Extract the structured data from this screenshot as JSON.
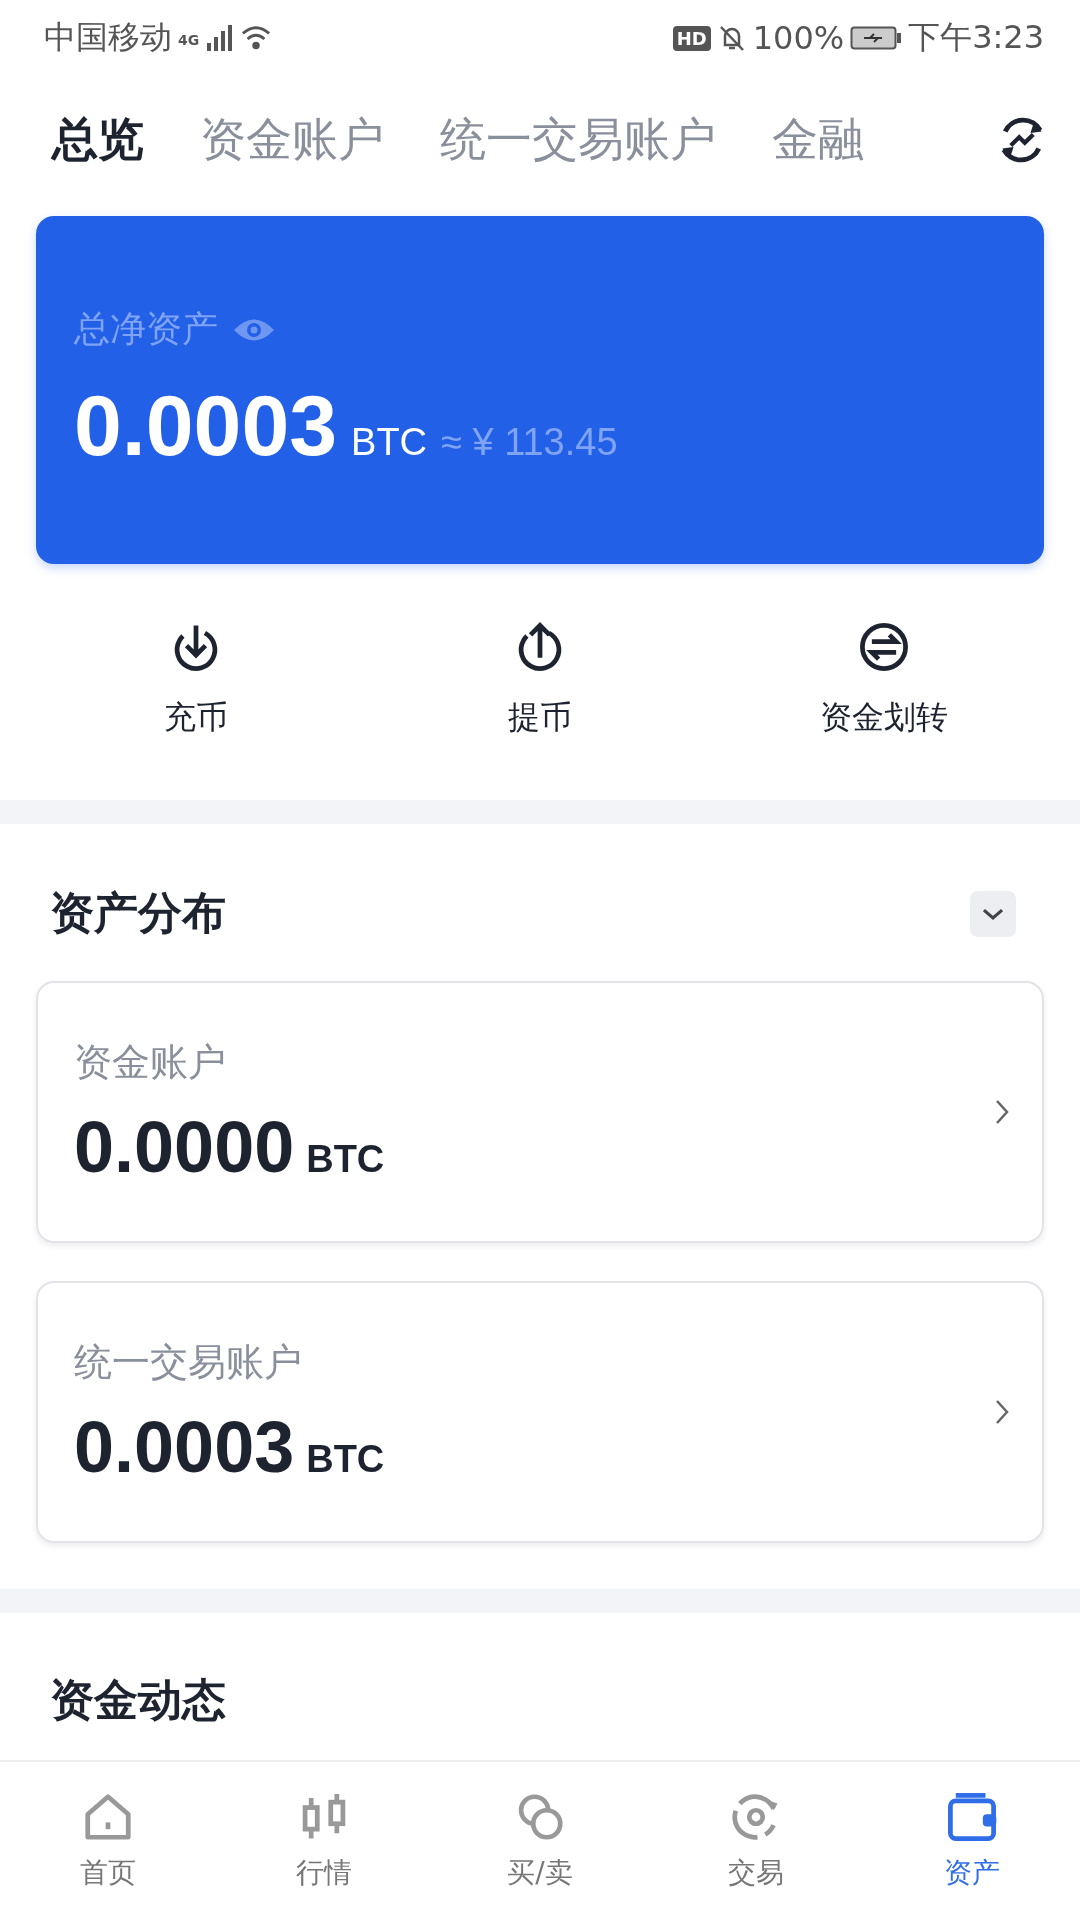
{
  "status_bar": {
    "carrier": "中国移动",
    "network": "4G",
    "hd": "HD",
    "battery": "100%",
    "time": "下午3:23"
  },
  "tabs": [
    {
      "label": "总览",
      "selected": true
    },
    {
      "label": "资金账户",
      "selected": false
    },
    {
      "label": "统一交易账户",
      "selected": false
    },
    {
      "label": "金融",
      "selected": false
    }
  ],
  "net_assets": {
    "label": "总净资产",
    "amount": "0.0003",
    "unit": "BTC",
    "approx": "≈ ¥ 113.45"
  },
  "actions": [
    {
      "label": "充币",
      "kind": "deposit"
    },
    {
      "label": "提币",
      "kind": "withdraw"
    },
    {
      "label": "资金划转",
      "kind": "transfer"
    }
  ],
  "distribution": {
    "title": "资产分布",
    "accounts": [
      {
        "name": "资金账户",
        "amount": "0.0000",
        "unit": "BTC"
      },
      {
        "name": "统一交易账户",
        "amount": "0.0003",
        "unit": "BTC"
      }
    ]
  },
  "activity": {
    "title": "资金动态"
  },
  "bottom_nav": [
    {
      "label": "首页",
      "kind": "home",
      "selected": false
    },
    {
      "label": "行情",
      "kind": "market",
      "selected": false
    },
    {
      "label": "买/卖",
      "kind": "buysell",
      "selected": false
    },
    {
      "label": "交易",
      "kind": "trade",
      "selected": false
    },
    {
      "label": "资产",
      "kind": "assets",
      "selected": true
    }
  ]
}
